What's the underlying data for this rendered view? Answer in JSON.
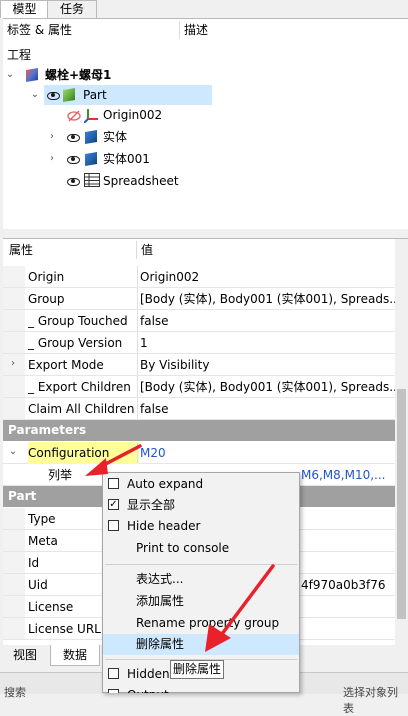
{
  "tabs": {
    "model": "模型",
    "tasks": "任务"
  },
  "tree": {
    "col_labels": "标签 & 属性",
    "col_desc": "描述",
    "root": "工程",
    "doc": "螺栓+螺母1",
    "part": "Part",
    "children": [
      "Origin002",
      "实体",
      "实体001",
      "Spreadsheet"
    ]
  },
  "props": {
    "col_prop": "属性",
    "col_val": "值",
    "rows": [
      {
        "name": "Origin",
        "value": "Origin002"
      },
      {
        "name": "Group",
        "value": "[Body (实体), Body001 (实体001), Spreads..."
      },
      {
        "name": "_ Group Touched",
        "value": "false"
      },
      {
        "name": "_ Group Version",
        "value": "1"
      },
      {
        "name": "Export Mode",
        "value": "By Visibility"
      },
      {
        "name": "_ Export Children",
        "value": "[Body (实体), Body001 (实体001), Spreads..."
      },
      {
        "name": "Claim All Children",
        "value": "false"
      }
    ],
    "group_parameters": "Parameters",
    "configuration": {
      "name": "Configuration",
      "value": "M20"
    },
    "enum_row": {
      "name": "列举",
      "value": "M6,M8,M10,..."
    },
    "group_part": "Part",
    "part_rows": [
      {
        "name": "Type",
        "value": ""
      },
      {
        "name": "Meta",
        "value": ""
      },
      {
        "name": "Id",
        "value": ""
      },
      {
        "name": "Uid",
        "value": "4f970a0b3f76"
      },
      {
        "name": "License",
        "value": ""
      },
      {
        "name": "License URL",
        "value": ""
      }
    ]
  },
  "bottom_tabs": {
    "view": "视图",
    "data": "数据"
  },
  "bottom_cut": {
    "left": "搜索",
    "right": "选择对象列表"
  },
  "menu": {
    "auto_expand": "Auto expand",
    "show_all": "显示全部",
    "hide_header": "Hide header",
    "print_console": "Print to console",
    "expression": "表达式...",
    "add_prop": "添加属性",
    "rename_group": "Rename property group",
    "remove_prop": "删除属性",
    "hidden": "Hidden",
    "next_cut": "Output"
  },
  "tooltip": "删除属性",
  "colors": {
    "config_bg": "#ffff99",
    "selection": "#cde8ff",
    "group_bg": "#a0a0a0",
    "arrow": "#e8212b"
  }
}
